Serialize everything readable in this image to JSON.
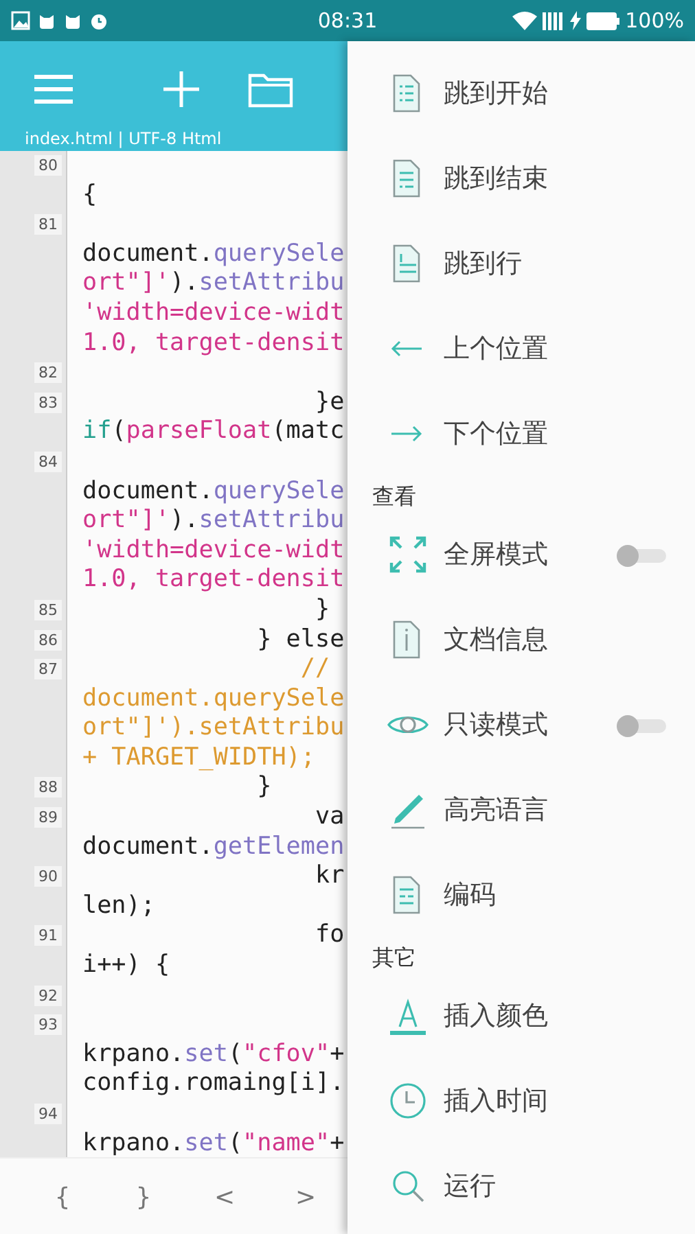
{
  "status_bar": {
    "time": "08:31",
    "battery": "100%"
  },
  "toolbar": {
    "subtitle": "index.html | UTF-8 Html"
  },
  "editor": {
    "lines": [
      {
        "number": "80",
        "rows": [
          {
            "kind": "blank"
          },
          {
            "kind": "code",
            "tokens": [
              {
                "text": "{",
                "kind": "plain"
              }
            ]
          }
        ]
      },
      {
        "number": "81",
        "rows": [
          {
            "kind": "blank"
          },
          {
            "kind": "code",
            "tokens": [
              {
                "text": "document.",
                "kind": "plain"
              },
              {
                "text": "querySele",
                "kind": "method"
              }
            ]
          },
          {
            "kind": "code",
            "tokens": [
              {
                "text": "ort\"]'",
                "kind": "string"
              },
              {
                "text": ").",
                "kind": "plain"
              },
              {
                "text": "setAttribu",
                "kind": "method"
              }
            ]
          },
          {
            "kind": "code",
            "tokens": [
              {
                "text": "'width=device-widt",
                "kind": "string"
              }
            ]
          },
          {
            "kind": "code",
            "tokens": [
              {
                "text": "1.0, target-densit",
                "kind": "string"
              }
            ]
          }
        ]
      },
      {
        "number": "82",
        "rows": [
          {
            "kind": "blank"
          }
        ]
      },
      {
        "number": "83",
        "rows": [
          {
            "kind": "code",
            "tokens": [
              {
                "text": "                }e",
                "kind": "plain"
              }
            ]
          },
          {
            "kind": "code",
            "tokens": [
              {
                "text": "if",
                "kind": "keyword"
              },
              {
                "text": "(",
                "kind": "plain"
              },
              {
                "text": "parseFloat",
                "kind": "string"
              },
              {
                "text": "(matc",
                "kind": "plain"
              }
            ]
          }
        ]
      },
      {
        "number": "84",
        "rows": [
          {
            "kind": "blank"
          },
          {
            "kind": "code",
            "tokens": [
              {
                "text": "document.",
                "kind": "plain"
              },
              {
                "text": "querySele",
                "kind": "method"
              }
            ]
          },
          {
            "kind": "code",
            "tokens": [
              {
                "text": "ort\"]'",
                "kind": "string"
              },
              {
                "text": ").",
                "kind": "plain"
              },
              {
                "text": "setAttribu",
                "kind": "method"
              }
            ]
          },
          {
            "kind": "code",
            "tokens": [
              {
                "text": "'width=device-widt",
                "kind": "string"
              }
            ]
          },
          {
            "kind": "code",
            "tokens": [
              {
                "text": "1.0, target-densit",
                "kind": "string"
              }
            ]
          }
        ]
      },
      {
        "number": "85",
        "rows": [
          {
            "kind": "code",
            "tokens": [
              {
                "text": "                }",
                "kind": "plain"
              }
            ]
          }
        ]
      },
      {
        "number": "86",
        "rows": [
          {
            "kind": "code",
            "tokens": [
              {
                "text": "            } else",
                "kind": "plain"
              }
            ]
          }
        ]
      },
      {
        "number": "87",
        "rows": [
          {
            "kind": "code",
            "tokens": [
              {
                "text": "               //",
                "kind": "comment"
              }
            ]
          },
          {
            "kind": "code",
            "tokens": [
              {
                "text": "document.querySele",
                "kind": "comment"
              }
            ]
          },
          {
            "kind": "code",
            "tokens": [
              {
                "text": "ort\"]').setAttribu",
                "kind": "comment"
              }
            ]
          },
          {
            "kind": "code",
            "tokens": [
              {
                "text": "+ TARGET_WIDTH);",
                "kind": "comment"
              }
            ]
          }
        ]
      },
      {
        "number": "88",
        "rows": [
          {
            "kind": "code",
            "tokens": [
              {
                "text": "            }",
                "kind": "plain"
              }
            ]
          }
        ]
      },
      {
        "number": "89",
        "rows": [
          {
            "kind": "code",
            "tokens": [
              {
                "text": "                va",
                "kind": "plain"
              }
            ]
          },
          {
            "kind": "code",
            "tokens": [
              {
                "text": "document.",
                "kind": "plain"
              },
              {
                "text": "getElemen",
                "kind": "method"
              }
            ]
          }
        ]
      },
      {
        "number": "90",
        "rows": [
          {
            "kind": "code",
            "tokens": [
              {
                "text": "                kr",
                "kind": "plain"
              }
            ]
          },
          {
            "kind": "code",
            "tokens": [
              {
                "text": "len);",
                "kind": "plain"
              }
            ]
          }
        ]
      },
      {
        "number": "91",
        "rows": [
          {
            "kind": "code",
            "tokens": [
              {
                "text": "                fo",
                "kind": "plain"
              }
            ]
          },
          {
            "kind": "code",
            "tokens": [
              {
                "text": "i++) {",
                "kind": "plain"
              }
            ]
          }
        ]
      },
      {
        "number": "92",
        "rows": [
          {
            "kind": "blank"
          }
        ]
      },
      {
        "number": "93",
        "rows": [
          {
            "kind": "blank"
          },
          {
            "kind": "code",
            "tokens": [
              {
                "text": "krpano.",
                "kind": "plain"
              },
              {
                "text": "set",
                "kind": "method"
              },
              {
                "text": "(",
                "kind": "plain"
              },
              {
                "text": "\"cfov\"",
                "kind": "string"
              },
              {
                "text": "+",
                "kind": "plain"
              }
            ]
          },
          {
            "kind": "code",
            "tokens": [
              {
                "text": "config.romaing[i].",
                "kind": "plain"
              }
            ]
          }
        ]
      },
      {
        "number": "94",
        "rows": [
          {
            "kind": "blank"
          },
          {
            "kind": "code",
            "tokens": [
              {
                "text": "krpano.",
                "kind": "plain"
              },
              {
                "text": "set",
                "kind": "method"
              },
              {
                "text": "(",
                "kind": "plain"
              },
              {
                "text": "\"name\"",
                "kind": "string"
              },
              {
                "text": "+",
                "kind": "plain"
              }
            ]
          }
        ]
      }
    ]
  },
  "symbol_bar": [
    "{",
    "}",
    "<",
    ">"
  ],
  "drawer": {
    "groups": [
      {
        "items": [
          {
            "label": "跳到开始",
            "kind": "action"
          },
          {
            "label": "跳到结束",
            "kind": "action"
          },
          {
            "label": "跳到行",
            "kind": "action"
          },
          {
            "label": "上个位置",
            "kind": "action"
          },
          {
            "label": "下个位置",
            "kind": "action"
          }
        ]
      },
      {
        "heading": "查看",
        "items": [
          {
            "label": "全屏模式",
            "kind": "toggle",
            "on": false
          },
          {
            "label": "文档信息",
            "kind": "action"
          },
          {
            "label": "只读模式",
            "kind": "toggle",
            "on": false
          },
          {
            "label": "高亮语言",
            "kind": "action"
          },
          {
            "label": "编码",
            "kind": "action"
          }
        ]
      },
      {
        "heading": "其它",
        "items": [
          {
            "label": "插入颜色",
            "kind": "action"
          },
          {
            "label": "插入时间",
            "kind": "action"
          },
          {
            "label": "运行",
            "kind": "action"
          }
        ]
      }
    ]
  }
}
